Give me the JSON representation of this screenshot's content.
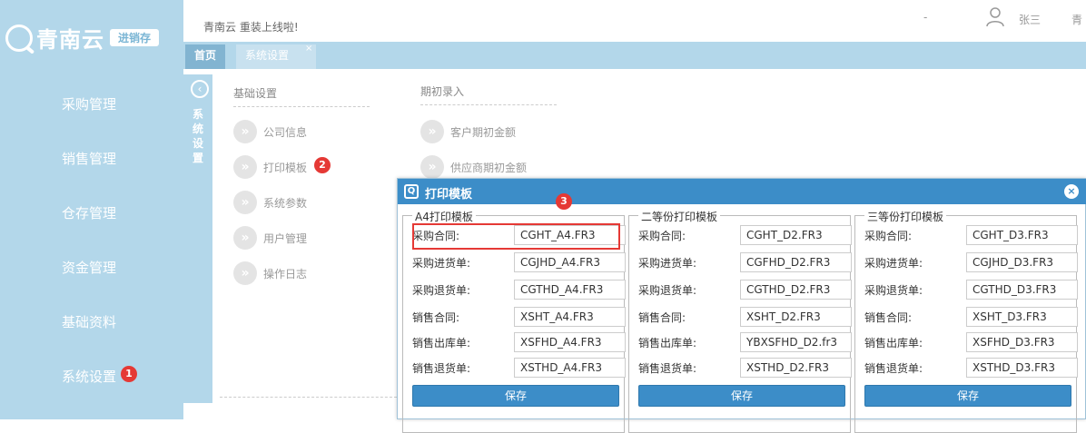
{
  "brand": {
    "name": "青南云",
    "badge": "进销存"
  },
  "sidebar": {
    "items": [
      {
        "label": "采购管理"
      },
      {
        "label": "销售管理"
      },
      {
        "label": "仓存管理"
      },
      {
        "label": "资金管理"
      },
      {
        "label": "基础资料"
      },
      {
        "label": "系统设置"
      }
    ]
  },
  "header": {
    "welcome": "青南云 重装上线啦!",
    "separator": "-",
    "username": "张三",
    "extra": "青"
  },
  "tabs": [
    {
      "label": "首页"
    },
    {
      "label": "系统设置"
    }
  ],
  "settings_strip": {
    "label": "系统设置"
  },
  "basic_settings": {
    "title": "基础设置",
    "items": [
      "公司信息",
      "打印模板",
      "系统参数",
      "用户管理",
      "操作日志"
    ]
  },
  "initial_entry": {
    "title": "期初录入",
    "items": [
      "客户期初金额",
      "供应商期初金额"
    ]
  },
  "steps": [
    "1",
    "2",
    "3"
  ],
  "dialog": {
    "title": "打印模板",
    "groups": [
      {
        "legend": "A4打印模板",
        "fields": [
          {
            "label": "采购合同:",
            "value": "CGHT_A4.FR3"
          },
          {
            "label": "采购进货单:",
            "value": "CGJHD_A4.FR3"
          },
          {
            "label": "采购退货单:",
            "value": "CGTHD_A4.FR3"
          },
          {
            "label": "销售合同:",
            "value": "XSHT_A4.FR3"
          },
          {
            "label": "销售出库单:",
            "value": "XSFHD_A4.FR3"
          },
          {
            "label": "销售退货单:",
            "value": "XSTHD_A4.FR3"
          }
        ],
        "save_label": "保存"
      },
      {
        "legend": "二等份打印模板",
        "fields": [
          {
            "label": "采购合同:",
            "value": "CGHT_D2.FR3"
          },
          {
            "label": "采购进货单:",
            "value": "CGFHD_D2.FR3"
          },
          {
            "label": "采购退货单:",
            "value": "CGTHD_D2.FR3"
          },
          {
            "label": "销售合同:",
            "value": "XSHT_D2.FR3"
          },
          {
            "label": "销售出库单:",
            "value": "YBXSFHD_D2.fr3"
          },
          {
            "label": "销售退货单:",
            "value": "XSTHD_D2.FR3"
          }
        ],
        "save_label": "保存"
      },
      {
        "legend": "三等份打印模板",
        "fields": [
          {
            "label": "采购合同:",
            "value": "CGHT_D3.FR3"
          },
          {
            "label": "采购进货单:",
            "value": "CGJHD_D3.FR3"
          },
          {
            "label": "采购退货单:",
            "value": "CGTHD_D3.FR3"
          },
          {
            "label": "销售合同:",
            "value": "XSHT_D3.FR3"
          },
          {
            "label": "销售出库单:",
            "value": "XSFHD_D3.FR3"
          },
          {
            "label": "销售退货单:",
            "value": "XSTHD_D3.FR3"
          }
        ],
        "save_label": "保存"
      }
    ]
  },
  "colors": {
    "sidebar_bg": "#b3d7ea",
    "dialog_accent": "#3c8dc8",
    "step_marker": "#e53935"
  }
}
